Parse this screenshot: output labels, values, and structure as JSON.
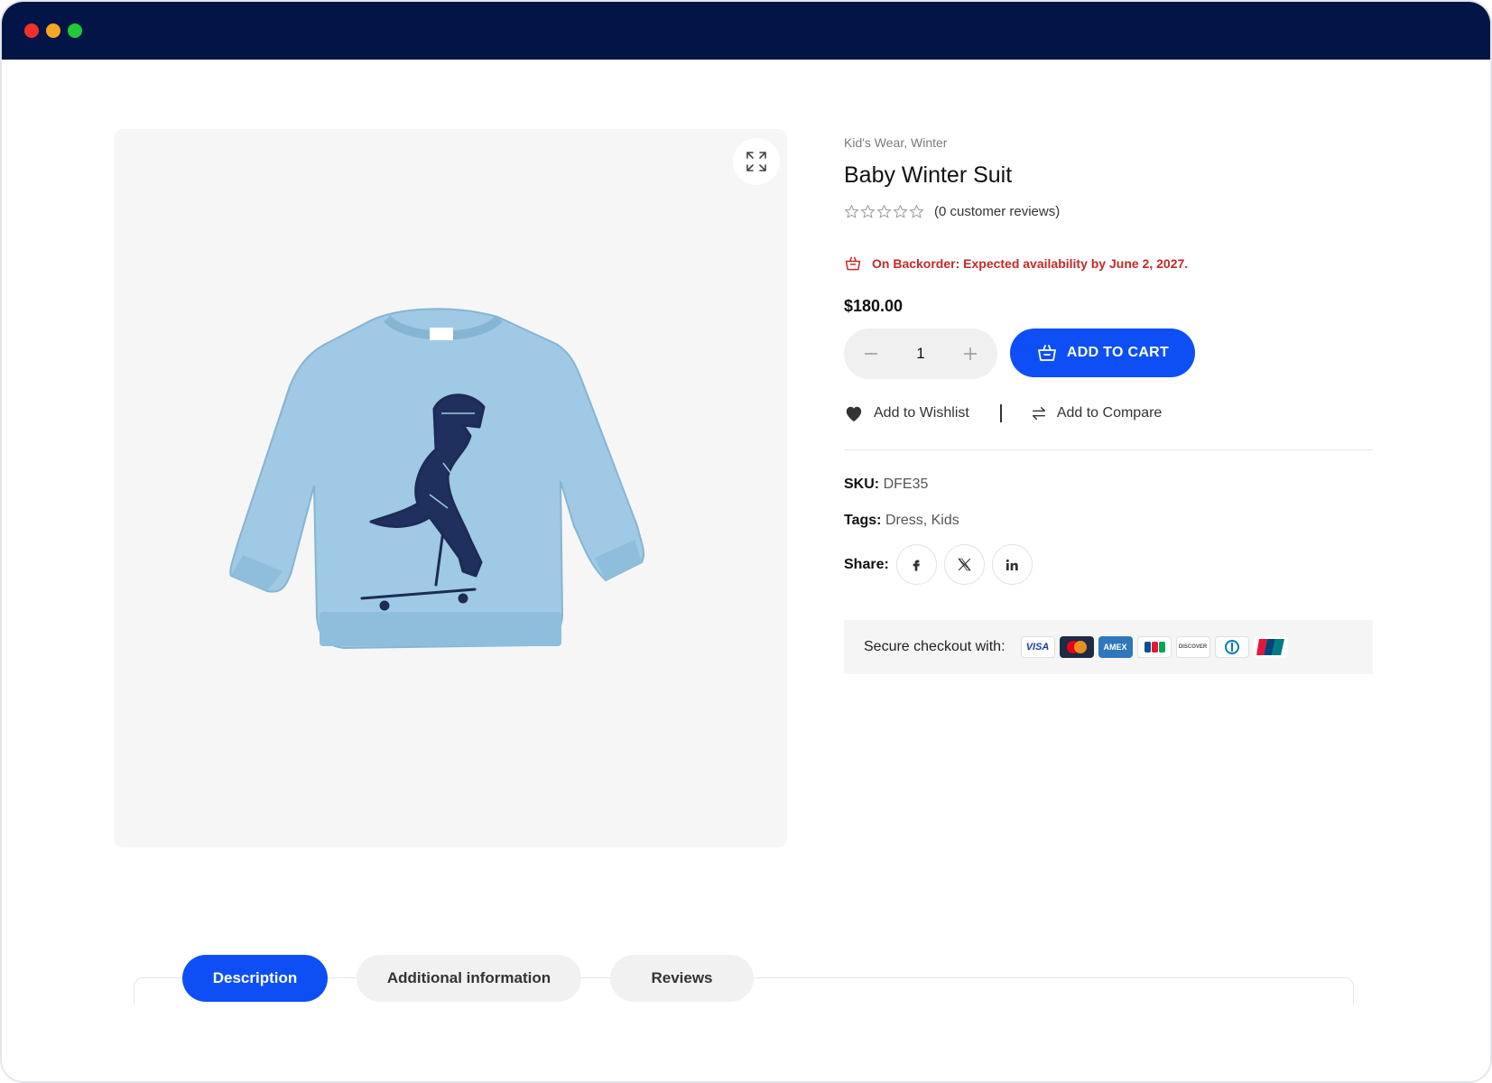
{
  "window": {
    "controls": [
      "close",
      "minimize",
      "maximize"
    ]
  },
  "gallery": {
    "zoom_icon": "expand-icon",
    "image_alt": "Light blue kids sweatshirt with dinosaur on skateboard print"
  },
  "product": {
    "categories": [
      "Kid's Wear",
      "Winter"
    ],
    "category_separator": ",",
    "title": "Baby Winter Suit",
    "rating": 0,
    "rating_max": 5,
    "reviews_text": "(0 customer reviews)",
    "backorder_text": "On Backorder: Expected availability by June 2, 2027.",
    "price": "$180.00",
    "quantity": "1",
    "add_to_cart": "ADD TO CART",
    "wishlist": "Add to Wishlist",
    "compare": "Add to Compare",
    "sku_label": "SKU:",
    "sku_value": "DFE35",
    "tags_label": "Tags:",
    "tags_value": "Dress, Kids",
    "share_label": "Share:",
    "share_icons": [
      "facebook-icon",
      "x-icon",
      "linkedin-icon"
    ],
    "checkout_label": "Secure checkout with:",
    "payment_cards": [
      {
        "name": "VISA",
        "icon": "visa-card-icon"
      },
      {
        "name": "Mastercard",
        "icon": "mastercard-icon"
      },
      {
        "name": "AMEX",
        "icon": "amex-card-icon"
      },
      {
        "name": "JCB",
        "icon": "jcb-card-icon"
      },
      {
        "name": "DISCOVER",
        "icon": "discover-card-icon"
      },
      {
        "name": "Diners",
        "icon": "diners-card-icon"
      },
      {
        "name": "UnionPay",
        "icon": "unionpay-card-icon"
      }
    ]
  },
  "tabs": [
    {
      "label": "Description",
      "active": true
    },
    {
      "label": "Additional information",
      "active": false
    },
    {
      "label": "Reviews",
      "active": false
    }
  ],
  "colors": {
    "titlebar": "#021546",
    "accent": "#0e4ff5",
    "backorder": "#c62828",
    "gallery_bg": "#f6f6f6"
  }
}
